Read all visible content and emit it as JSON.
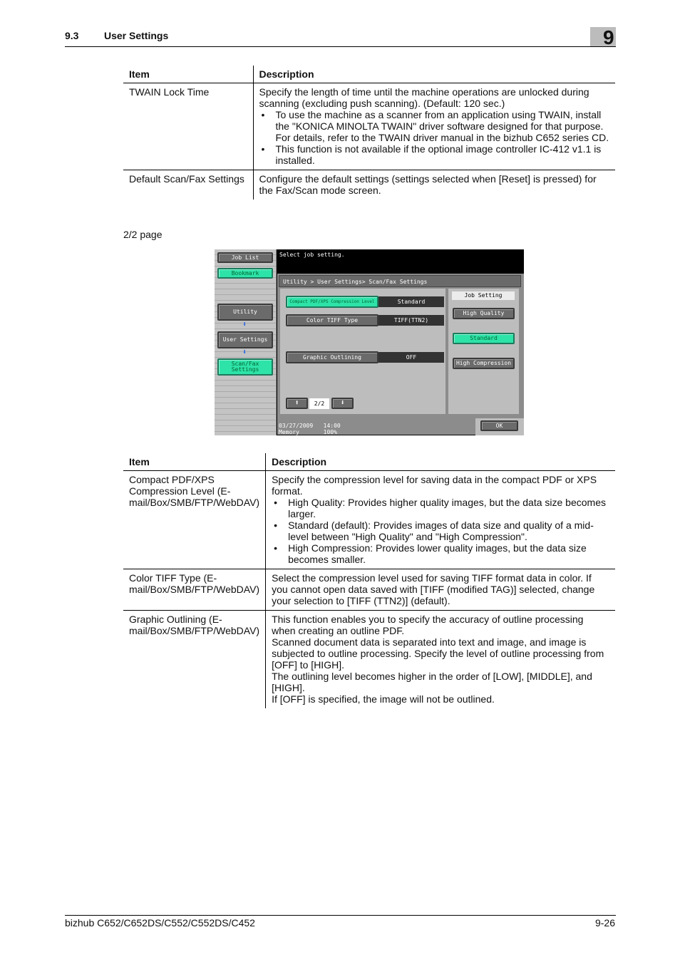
{
  "header": {
    "section_number": "9.3",
    "section_title": "User Settings",
    "chapter_number": "9"
  },
  "table1": {
    "headers": {
      "item": "Item",
      "description": "Description"
    },
    "rows": [
      {
        "item": "TWAIN Lock Time",
        "intro": "Specify the length of time until the machine operations are unlocked during scanning (excluding push scanning). (Default: 120 sec.)",
        "bullets": [
          "To use the machine as a scanner from an application using TWAIN, install the \"KONICA MINOLTA TWAIN\" driver software designed for that purpose. For details, refer to the TWAIN driver manual in the bizhub C652 series CD.",
          "This function is not available if the optional image controller IC-412 v1.1 is installed."
        ]
      },
      {
        "item": "Default Scan/Fax Settings",
        "intro": "Configure the default settings (settings selected when [Reset] is pressed) for the Fax/Scan mode screen."
      }
    ]
  },
  "page_caption": "2/2 page",
  "screen": {
    "left_panel": {
      "job_list": "Job List",
      "bookmark": "Bookmark",
      "utility": "Utility",
      "user_settings": "User Settings",
      "scan_fax_settings": "Scan/Fax Settings"
    },
    "message": "Select job setting.",
    "breadcrumb": "Utility > User Settings> Scan/Fax Settings",
    "settings": [
      {
        "label": "Compact PDF/XPS Compression Level",
        "value": "Standard",
        "selected": true
      },
      {
        "label": "Color TIFF Type",
        "value": "TIFF(TTN2)",
        "selected": false
      },
      {
        "label": "Graphic Outlining",
        "value": "OFF",
        "selected": false
      }
    ],
    "job_setting": {
      "title": "Job Setting",
      "options": [
        {
          "label": "High Quality",
          "selected": false
        },
        {
          "label": "Standard",
          "selected": true
        },
        {
          "label": "High Compression",
          "selected": false
        }
      ]
    },
    "pager": {
      "text": "2/2",
      "up_icon": "up-arrow",
      "down_icon": "down-arrow"
    },
    "status": {
      "date": "03/27/2009",
      "time": "14:00",
      "memory_label": "Memory",
      "memory_value": "100%"
    },
    "ok": "OK",
    "colors": {
      "selected": "#2ee3a8",
      "button": "#6b6b6b",
      "background": "#bdbdbd"
    }
  },
  "table2": {
    "headers": {
      "item": "Item",
      "description": "Description"
    },
    "rows": [
      {
        "item": "Compact PDF/XPS Compression Level (E-mail/Box/SMB/FTP/WebDAV)",
        "intro": "Specify the compression level for saving data in the compact PDF or XPS format.",
        "bullets": [
          "High Quality: Provides higher quality images, but the data size becomes larger.",
          "Standard (default): Provides images of data size and quality of a mid-level between \"High Quality\" and \"High Compression\".",
          "High Compression: Provides lower quality images, but the data size becomes smaller."
        ]
      },
      {
        "item": "Color TIFF Type (E-mail/Box/SMB/FTP/WebDAV)",
        "intro": "Select the compression level used for saving TIFF format data in color. If you cannot open data saved with [TIFF (modified TAG)] selected, change your selection to [TIFF (TTN2)] (default)."
      },
      {
        "item": "Graphic Outlining (E-mail/Box/SMB/FTP/WebDAV)",
        "paragraphs": [
          "This function enables you to specify the accuracy of outline processing when creating an outline PDF.",
          "Scanned document data is separated into text and image, and image is subjected to outline processing. Specify the level of outline processing from [OFF] to [HIGH].",
          "The outlining level becomes higher in the order of [LOW], [MIDDLE], and [HIGH].",
          "If [OFF] is specified, the image will not be outlined."
        ]
      }
    ]
  },
  "footer": {
    "product": "bizhub C652/C652DS/C552/C552DS/C452",
    "page": "9-26"
  }
}
